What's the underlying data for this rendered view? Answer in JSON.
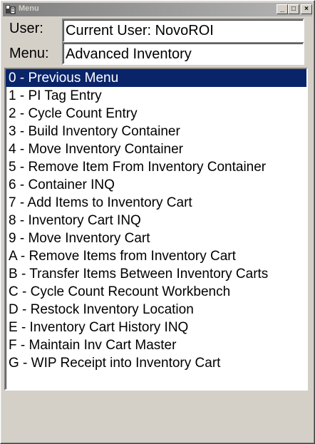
{
  "window": {
    "title": "Menu"
  },
  "fields": {
    "user_label": "User:",
    "user_value": "Current User: NovoROI",
    "menu_label": "Menu:",
    "menu_value": "Advanced Inventory"
  },
  "menu_items": [
    "0 - Previous Menu",
    "1 - PI Tag Entry",
    "2 - Cycle Count Entry",
    "3 - Build Inventory Container",
    "4 - Move Inventory Container",
    "5 - Remove Item From Inventory Container",
    "6 - Container INQ",
    "7 - Add Items to Inventory Cart",
    "8 - Inventory Cart INQ",
    "9 - Move Inventory Cart",
    "A - Remove Items from Inventory Cart",
    "B - Transfer Items Between Inventory Carts",
    "C - Cycle Count Recount Workbench",
    "D - Restock Inventory Location",
    "E - Inventory Cart History INQ",
    "F - Maintain Inv Cart Master",
    "G - WIP Receipt into Inventory Cart"
  ],
  "selected_index": 0,
  "icons": {
    "app": "app-icon",
    "minimize": "minimize-icon",
    "maximize": "maximize-icon",
    "close": "close-icon"
  }
}
